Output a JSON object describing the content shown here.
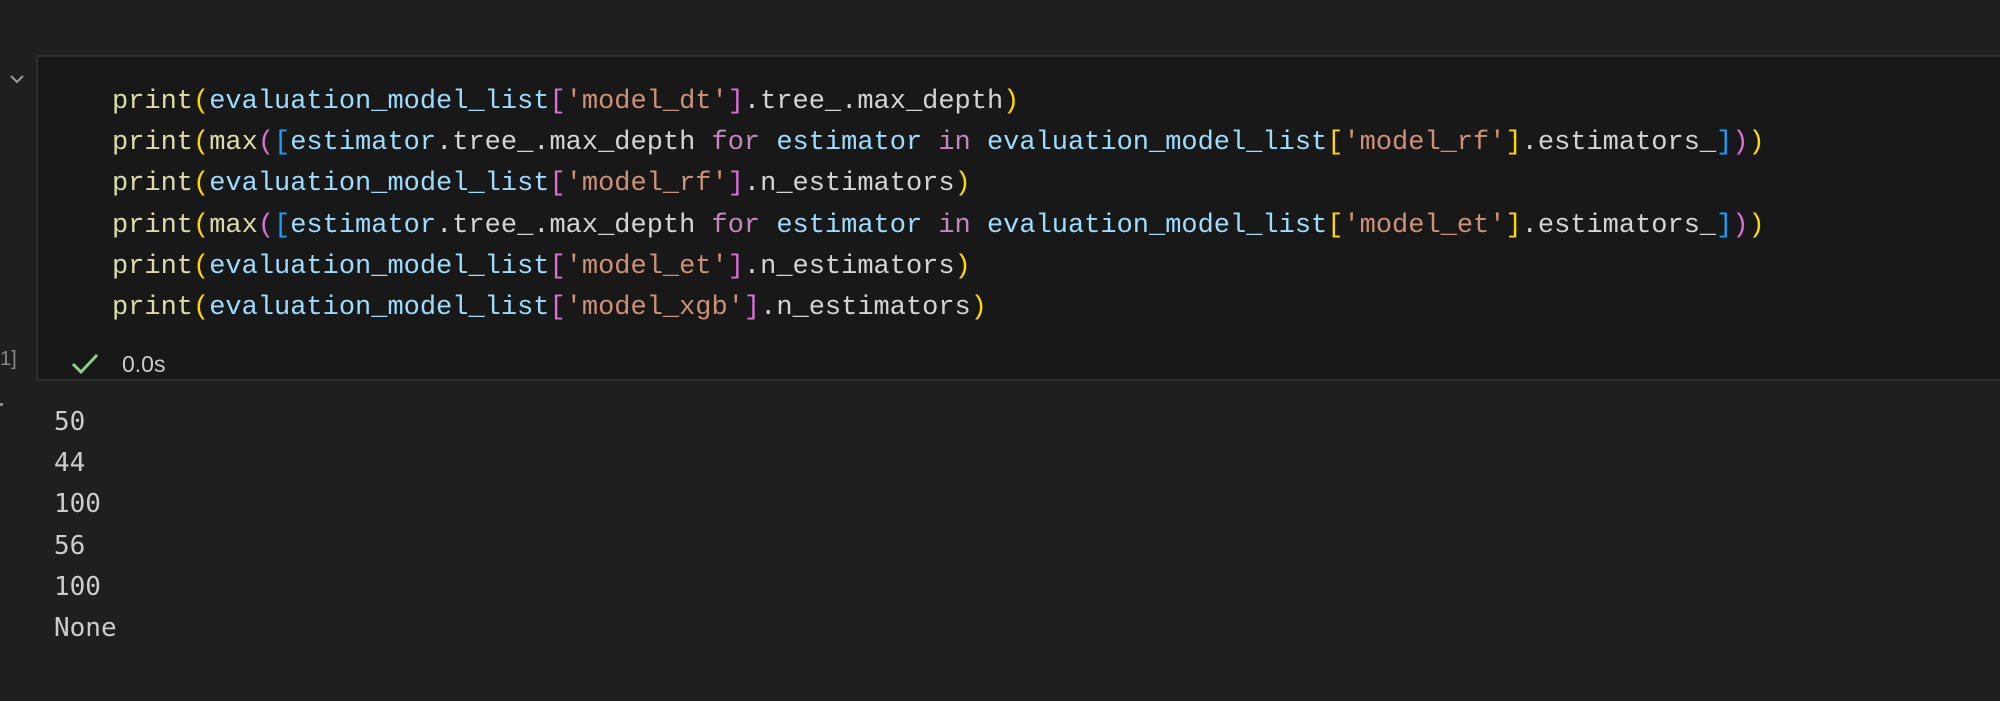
{
  "cell": {
    "execution_count": "1]",
    "code_lines": [
      [
        {
          "t": "print",
          "c": "fn"
        },
        {
          "t": "(",
          "c": "p1"
        },
        {
          "t": "evaluation_model_list",
          "c": "var"
        },
        {
          "t": "[",
          "c": "p2"
        },
        {
          "t": "'model_dt'",
          "c": "str"
        },
        {
          "t": "]",
          "c": "p2"
        },
        {
          "t": ".tree_.max_depth",
          "c": "plain"
        },
        {
          "t": ")",
          "c": "p1"
        }
      ],
      [
        {
          "t": "print",
          "c": "fn"
        },
        {
          "t": "(",
          "c": "p1"
        },
        {
          "t": "max",
          "c": "fn"
        },
        {
          "t": "(",
          "c": "p2"
        },
        {
          "t": "[",
          "c": "p3"
        },
        {
          "t": "estimator",
          "c": "var"
        },
        {
          "t": ".tree_.max_depth ",
          "c": "plain"
        },
        {
          "t": "for",
          "c": "kw"
        },
        {
          "t": " ",
          "c": "plain"
        },
        {
          "t": "estimator",
          "c": "var"
        },
        {
          "t": " ",
          "c": "plain"
        },
        {
          "t": "in",
          "c": "kw"
        },
        {
          "t": " ",
          "c": "plain"
        },
        {
          "t": "evaluation_model_list",
          "c": "var"
        },
        {
          "t": "[",
          "c": "p1"
        },
        {
          "t": "'model_rf'",
          "c": "str"
        },
        {
          "t": "]",
          "c": "p1"
        },
        {
          "t": ".estimators_",
          "c": "plain"
        },
        {
          "t": "]",
          "c": "p3"
        },
        {
          "t": ")",
          "c": "p2"
        },
        {
          "t": ")",
          "c": "p1"
        }
      ],
      [
        {
          "t": "print",
          "c": "fn"
        },
        {
          "t": "(",
          "c": "p1"
        },
        {
          "t": "evaluation_model_list",
          "c": "var"
        },
        {
          "t": "[",
          "c": "p2"
        },
        {
          "t": "'model_rf'",
          "c": "str"
        },
        {
          "t": "]",
          "c": "p2"
        },
        {
          "t": ".n_estimators",
          "c": "plain"
        },
        {
          "t": ")",
          "c": "p1"
        }
      ],
      [
        {
          "t": "print",
          "c": "fn"
        },
        {
          "t": "(",
          "c": "p1"
        },
        {
          "t": "max",
          "c": "fn"
        },
        {
          "t": "(",
          "c": "p2"
        },
        {
          "t": "[",
          "c": "p3"
        },
        {
          "t": "estimator",
          "c": "var"
        },
        {
          "t": ".tree_.max_depth ",
          "c": "plain"
        },
        {
          "t": "for",
          "c": "kw"
        },
        {
          "t": " ",
          "c": "plain"
        },
        {
          "t": "estimator",
          "c": "var"
        },
        {
          "t": " ",
          "c": "plain"
        },
        {
          "t": "in",
          "c": "kw"
        },
        {
          "t": " ",
          "c": "plain"
        },
        {
          "t": "evaluation_model_list",
          "c": "var"
        },
        {
          "t": "[",
          "c": "p1"
        },
        {
          "t": "'model_et'",
          "c": "str"
        },
        {
          "t": "]",
          "c": "p1"
        },
        {
          "t": ".estimators_",
          "c": "plain"
        },
        {
          "t": "]",
          "c": "p3"
        },
        {
          "t": ")",
          "c": "p2"
        },
        {
          "t": ")",
          "c": "p1"
        }
      ],
      [
        {
          "t": "print",
          "c": "fn"
        },
        {
          "t": "(",
          "c": "p1"
        },
        {
          "t": "evaluation_model_list",
          "c": "var"
        },
        {
          "t": "[",
          "c": "p2"
        },
        {
          "t": "'model_et'",
          "c": "str"
        },
        {
          "t": "]",
          "c": "p2"
        },
        {
          "t": ".n_estimators",
          "c": "plain"
        },
        {
          "t": ")",
          "c": "p1"
        }
      ],
      [
        {
          "t": "print",
          "c": "fn"
        },
        {
          "t": "(",
          "c": "p1"
        },
        {
          "t": "evaluation_model_list",
          "c": "var"
        },
        {
          "t": "[",
          "c": "p2"
        },
        {
          "t": "'model_xgb'",
          "c": "str"
        },
        {
          "t": "]",
          "c": "p2"
        },
        {
          "t": ".n_estimators",
          "c": "plain"
        },
        {
          "t": ")",
          "c": "p1"
        }
      ]
    ],
    "status": {
      "icon": "check-icon",
      "duration": "0.0s",
      "success_color": "#89d185"
    }
  },
  "output": {
    "lines": [
      "50",
      "44",
      "100",
      "56",
      "100",
      "None"
    ]
  },
  "colors": {
    "background": "#1f1f1f",
    "cell_background": "#181818",
    "function": "#dcdcaa",
    "variable": "#9cdcfe",
    "string": "#ce9178",
    "keyword": "#c586c0",
    "bracket_level_1": "#ffd700",
    "bracket_level_2": "#da70d6",
    "bracket_level_3": "#179fff"
  }
}
